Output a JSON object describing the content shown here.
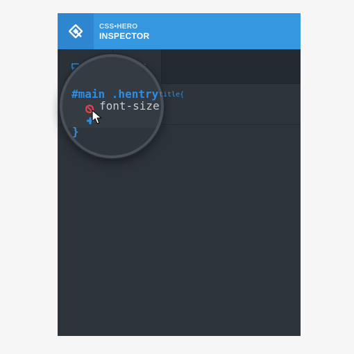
{
  "header": {
    "brand_top": "CSS•HERO",
    "brand_main": "INSPECTOR",
    "logo_icon": "diamond-logo-icon"
  },
  "tabs": [
    {
      "icon": "monitor-icon"
    },
    {
      "icon": "search-icon"
    }
  ],
  "editor": {
    "selector_main": "#main .hentry",
    "selector_tail": "title{",
    "property": "font-size",
    "close_brace": "}",
    "remove_icon": "remove-property-icon",
    "add_icon": "add-property-icon",
    "cursor_icon": "mouse-cursor-icon"
  },
  "colors": {
    "accent": "#3597e0",
    "accent_dark": "#2d86cf",
    "panel_bg": "#2d333b",
    "code_blue": "#2d8fe4",
    "remove_red": "#e5424d",
    "text_light": "#c8ccd1"
  }
}
